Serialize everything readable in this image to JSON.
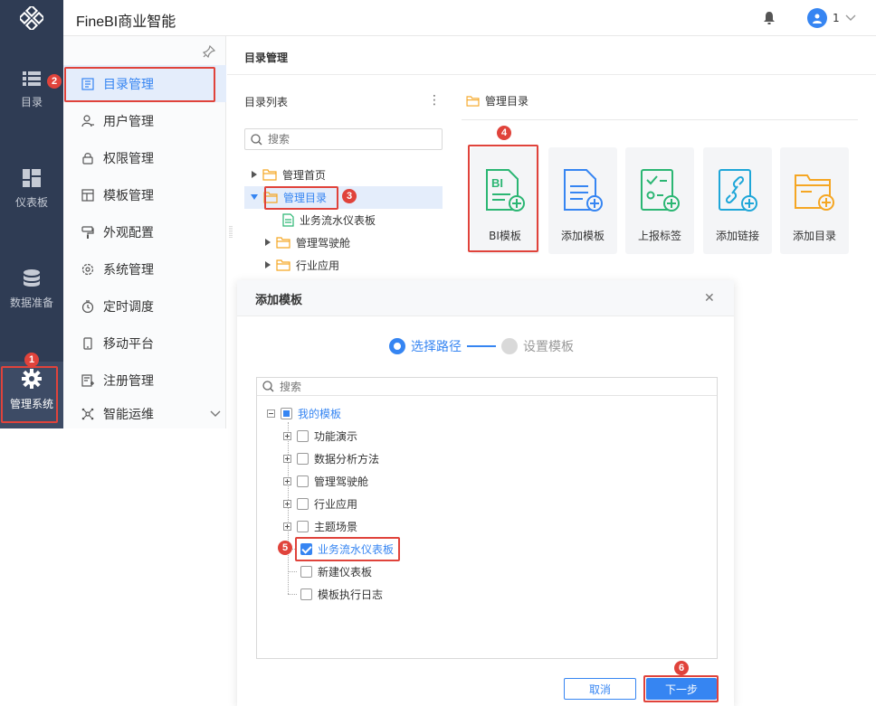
{
  "app": {
    "title": "FineBI商业智能",
    "user_name": "1"
  },
  "leftnav": {
    "items": [
      {
        "label": "目录",
        "icon": "list-icon"
      },
      {
        "label": "仪表板",
        "icon": "dashboard-icon"
      },
      {
        "label": "数据准备",
        "icon": "database-icon"
      },
      {
        "label": "管理系统",
        "icon": "gear-icon"
      }
    ]
  },
  "subnav": {
    "items": [
      {
        "label": "目录管理",
        "icon": "catalog-icon"
      },
      {
        "label": "用户管理",
        "icon": "user-icon"
      },
      {
        "label": "权限管理",
        "icon": "lock-icon"
      },
      {
        "label": "模板管理",
        "icon": "template-icon"
      },
      {
        "label": "外观配置",
        "icon": "paint-icon"
      },
      {
        "label": "系统管理",
        "icon": "settings-icon"
      },
      {
        "label": "定时调度",
        "icon": "timer-icon"
      },
      {
        "label": "移动平台",
        "icon": "mobile-icon"
      },
      {
        "label": "注册管理",
        "icon": "register-icon"
      },
      {
        "label": "智能运维",
        "icon": "ops-icon"
      }
    ]
  },
  "main": {
    "title": "目录管理"
  },
  "tree": {
    "title": "目录列表",
    "search_placeholder": "搜索",
    "nodes": [
      {
        "label": "管理首页"
      },
      {
        "label": "管理目录"
      },
      {
        "label": "业务流水仪表板"
      },
      {
        "label": "管理驾驶舱"
      },
      {
        "label": "行业应用"
      }
    ]
  },
  "right_panel": {
    "title": "管理目录",
    "cards": [
      {
        "label": "BI模板",
        "icon": "bi-template-icon",
        "icon_text": "BI"
      },
      {
        "label": "添加模板",
        "icon": "add-template-icon"
      },
      {
        "label": "上报标签",
        "icon": "report-tag-icon"
      },
      {
        "label": "添加链接",
        "icon": "add-link-icon"
      },
      {
        "label": "添加目录",
        "icon": "add-folder-icon"
      }
    ]
  },
  "dialog": {
    "title": "添加模板",
    "step1": "选择路径",
    "step2": "设置模板",
    "search_placeholder": "搜索",
    "root_label": "我的模板",
    "items": [
      {
        "label": "功能演示"
      },
      {
        "label": "数据分析方法"
      },
      {
        "label": "管理驾驶舱"
      },
      {
        "label": "行业应用"
      },
      {
        "label": "主题场景"
      },
      {
        "label": "业务流水仪表板"
      },
      {
        "label": "新建仪表板"
      },
      {
        "label": "模板执行日志"
      }
    ],
    "cancel_label": "取消",
    "next_label": "下一步"
  },
  "badges": [
    "1",
    "2",
    "3",
    "4",
    "5",
    "6"
  ],
  "colors": {
    "accent": "#3685f2",
    "nav_bg": "#2f3c54",
    "highlight": "#e0433b",
    "folder": "#f5a623",
    "green": "#2bb673"
  }
}
